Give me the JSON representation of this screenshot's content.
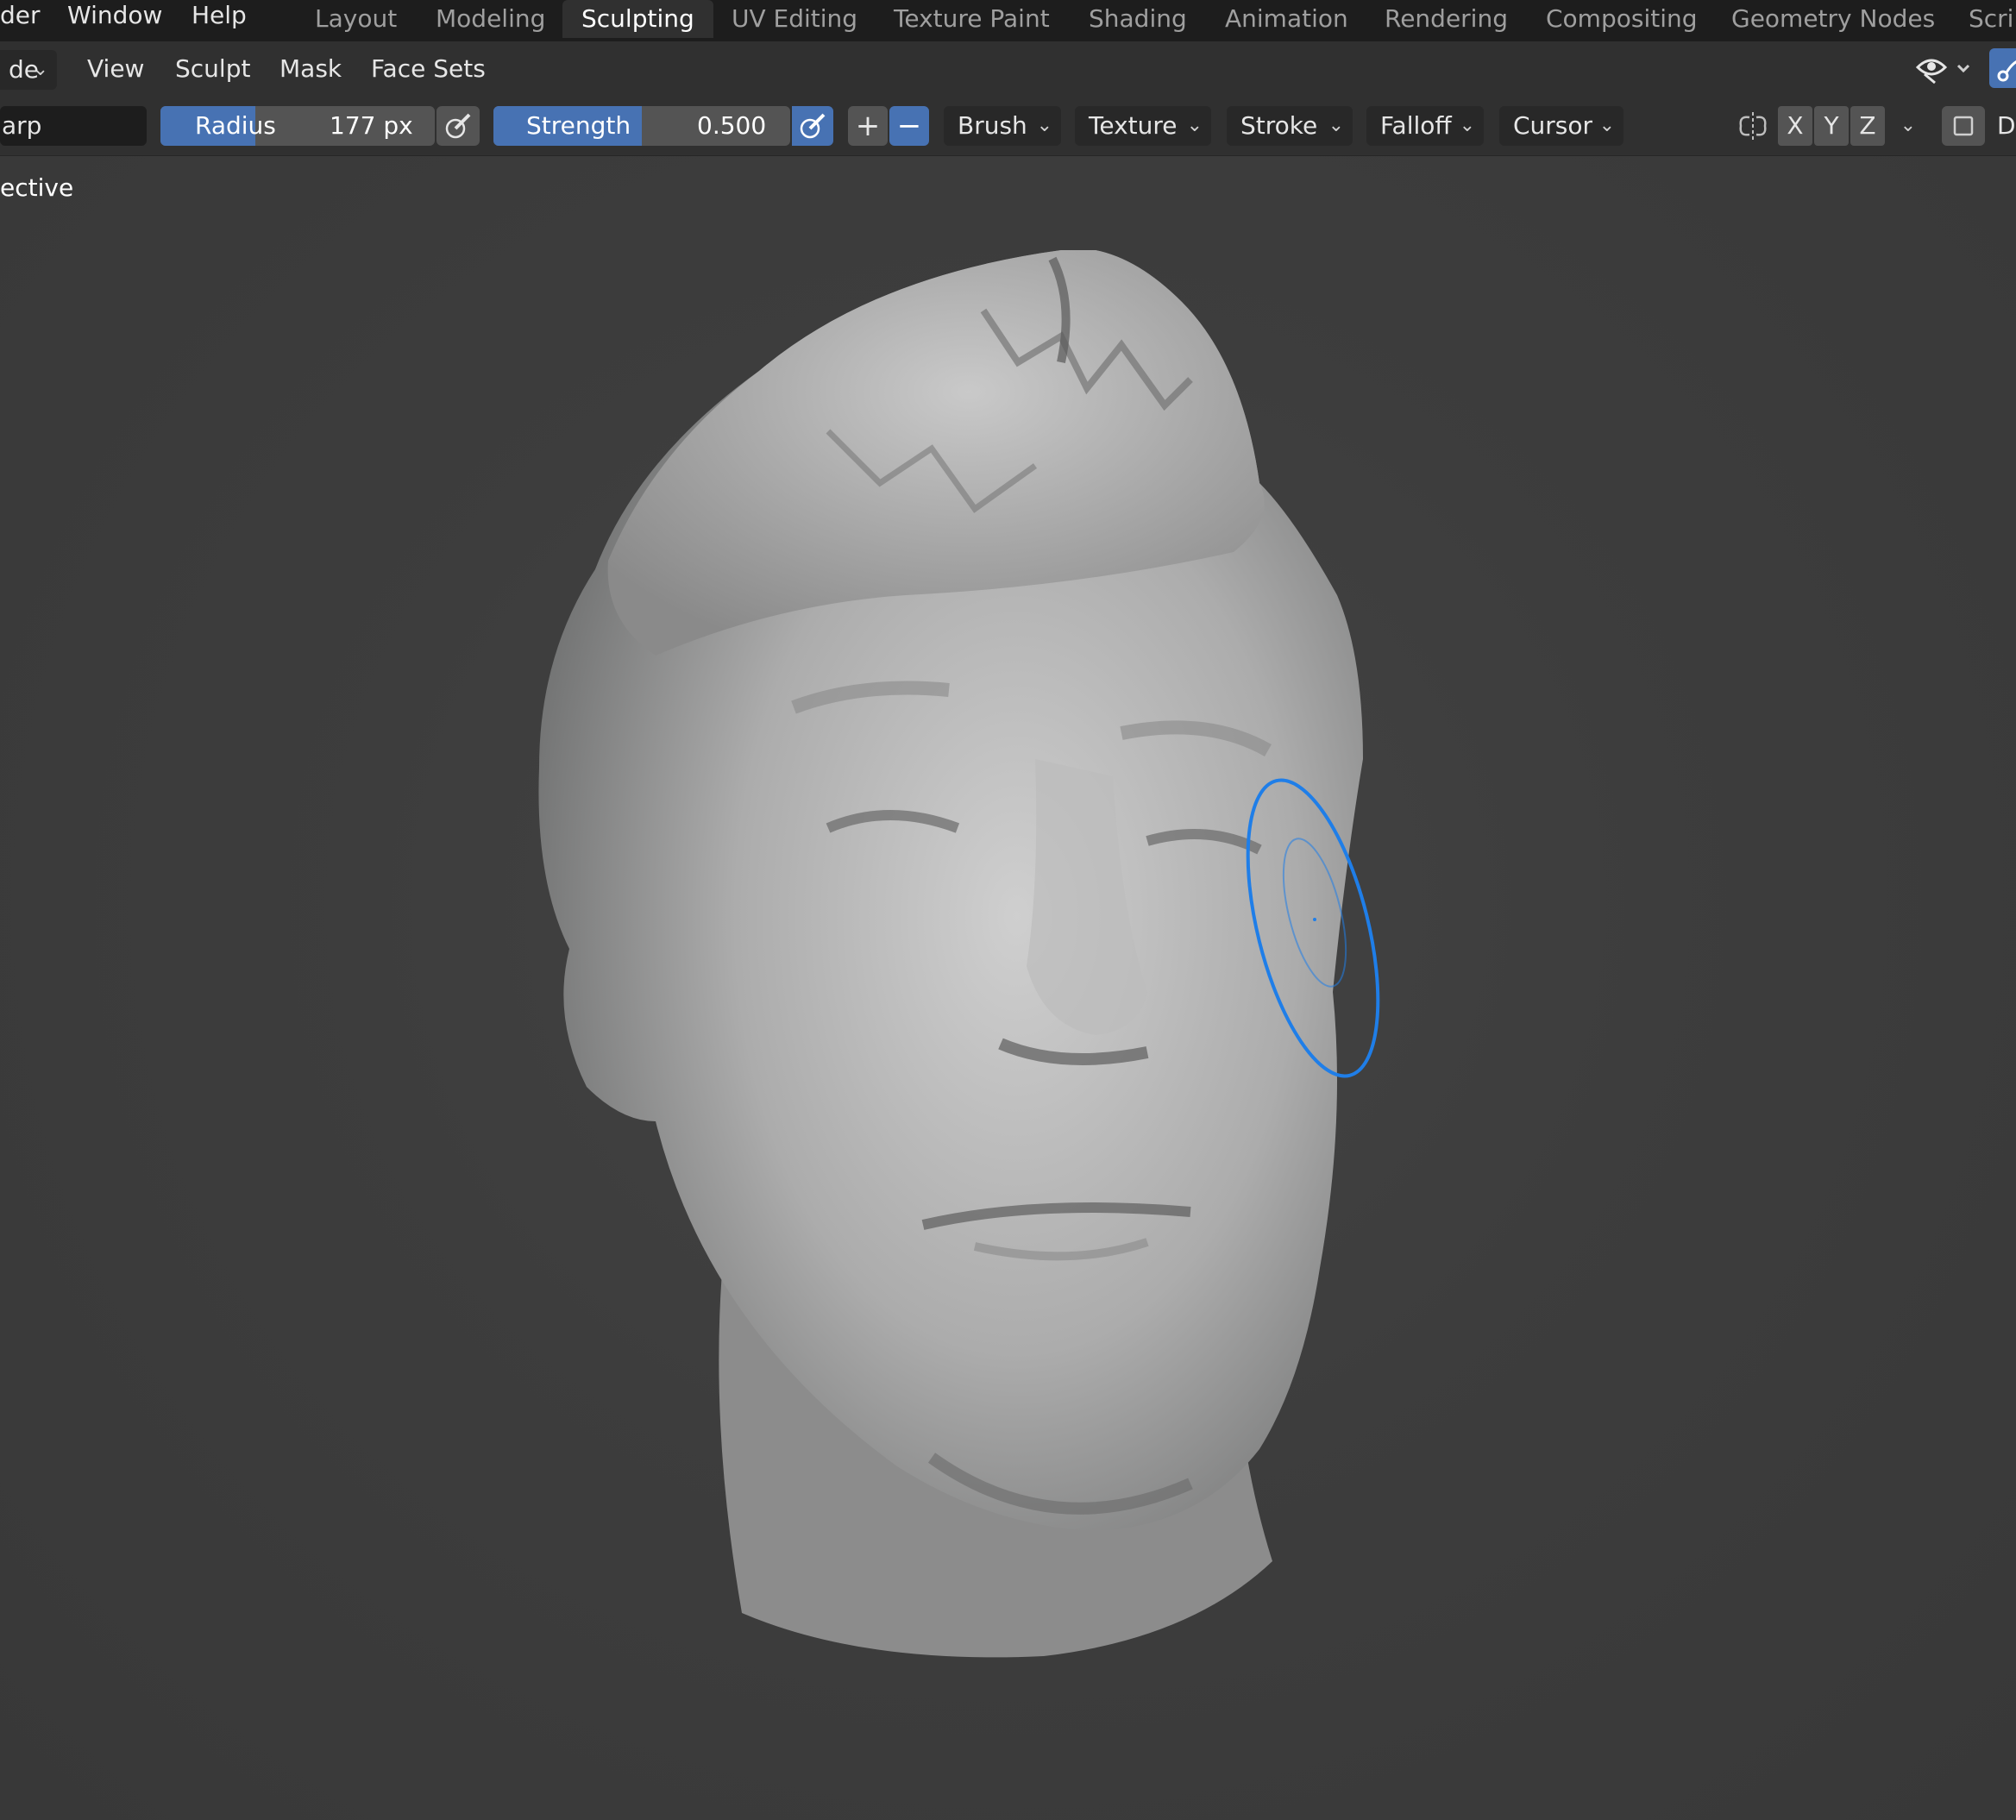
{
  "menubar": {
    "items": [
      "der",
      "Window",
      "Help"
    ]
  },
  "workspace_tabs": [
    "Layout",
    "Modeling",
    "Sculpting",
    "UV Editing",
    "Texture Paint",
    "Shading",
    "Animation",
    "Rendering",
    "Compositing",
    "Geometry Nodes",
    "Scrip"
  ],
  "active_tab": "Sculpting",
  "header": {
    "mode_label": "de",
    "menus": [
      "View",
      "Sculpt",
      "Mask",
      "Face Sets"
    ]
  },
  "toolbar": {
    "brush_name": "arp",
    "radius": {
      "label": "Radius",
      "value": "177 px"
    },
    "strength": {
      "label": "Strength",
      "value": "0.500",
      "fraction": 0.5
    },
    "add_symbol": "+",
    "subtract_symbol": "−",
    "dropdowns": [
      "Brush",
      "Texture",
      "Stroke",
      "Falloff",
      "Cursor"
    ],
    "axes": [
      "X",
      "Y",
      "Z"
    ],
    "trailing_label": "D"
  },
  "viewport": {
    "view_label": "ective"
  },
  "colors": {
    "accent": "#4772b3",
    "brush_cursor": "#1f7ee8",
    "background": "#3c3c3c",
    "mesh": "#b4b4b4"
  },
  "icons": [
    "eye-icon",
    "gizmo-icon",
    "pen-pressure-icon",
    "symmetry-icon",
    "chevron-down-icon",
    "checkbox-icon"
  ]
}
